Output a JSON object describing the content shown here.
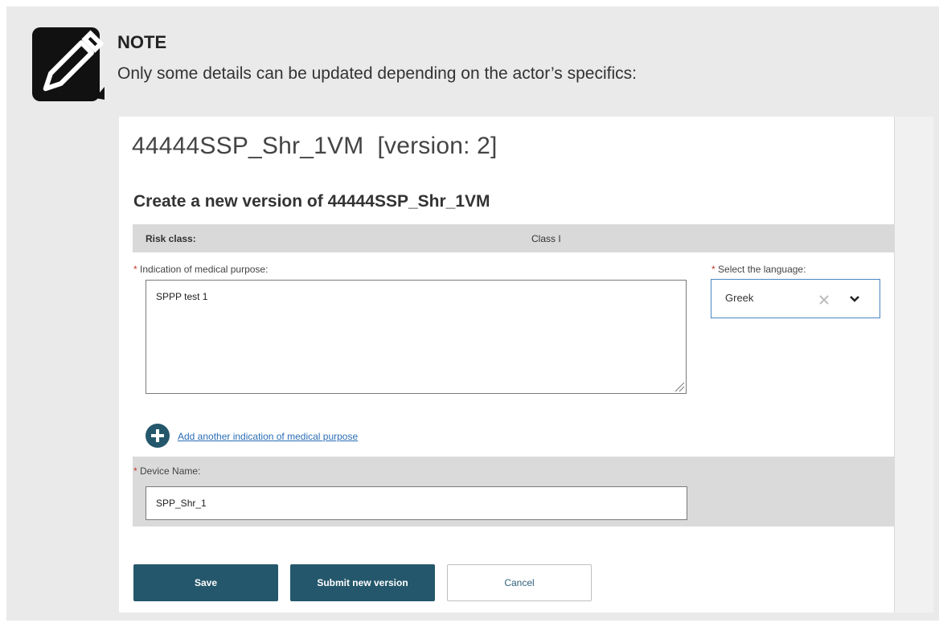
{
  "note": {
    "title": "NOTE",
    "text": "Only some details can be updated depending on the actor’s specifics:",
    "icon": "pencil-icon"
  },
  "form": {
    "page_title": "44444SSP_Shr_1VM  [version: 2]",
    "section_title": "Create a new version of 44444SSP_Shr_1VM",
    "risk_class": {
      "label": "Risk class:",
      "value": "Class I"
    },
    "indication": {
      "required_mark": "*",
      "label": "Indication of medical purpose:",
      "value": "SPPP test 1"
    },
    "language": {
      "required_mark": "*",
      "label": "Select the language:",
      "value": "Greek"
    },
    "add_indication_link": "Add another indication of medical purpose",
    "device_name": {
      "required_mark": "*",
      "label": "Device Name:",
      "value": "SPP_Shr_1"
    },
    "buttons": {
      "save": "Save",
      "submit": "Submit new version",
      "cancel": "Cancel"
    }
  },
  "colors": {
    "primary_button": "#24576b",
    "link": "#2a6db5",
    "required": "#c0392b",
    "note_background": "#eaeaea"
  }
}
